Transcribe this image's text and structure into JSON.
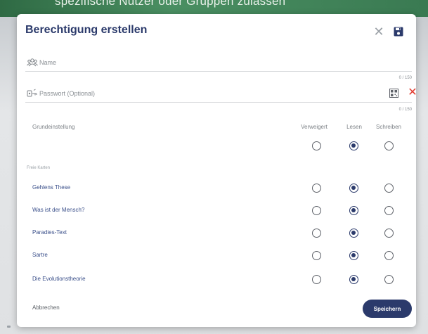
{
  "background": {
    "banner_text": "spezifische Nutzer oder Gruppen zulassen"
  },
  "dialog": {
    "title": "Berechtigung erstellen",
    "close_icon": "close-icon",
    "save_icon": "floppy-disk-icon",
    "name_field": {
      "icon": "users-icon",
      "placeholder": "Name",
      "value": "",
      "counter": "0 / 150"
    },
    "password_field": {
      "icon": "key-icon",
      "placeholder": "Passwort (Optional)",
      "value": "",
      "counter": "0 / 150",
      "qr_icon": "qr-code-icon",
      "clear_icon": "close-icon"
    },
    "default_section": {
      "label": "Grundeinstellung",
      "columns": [
        "Verweigert",
        "Lesen",
        "Schreiben"
      ],
      "selected": "Lesen"
    },
    "cards_section": {
      "label": "Freie Karten",
      "rows": [
        {
          "label": "Gehlens These",
          "selected": "Lesen"
        },
        {
          "label": "Was ist der Mensch?",
          "selected": "Lesen"
        },
        {
          "label": "Paradies-Text",
          "selected": "Lesen"
        },
        {
          "label": "Sartre",
          "selected": "Lesen"
        },
        {
          "label": "Die Evolutionstheorie",
          "selected": "Lesen"
        }
      ]
    },
    "footer": {
      "cancel_label": "Abbrechen",
      "save_label": "Speichern"
    },
    "colors": {
      "primary": "#2b3a6b",
      "danger": "#e23a2e"
    }
  }
}
